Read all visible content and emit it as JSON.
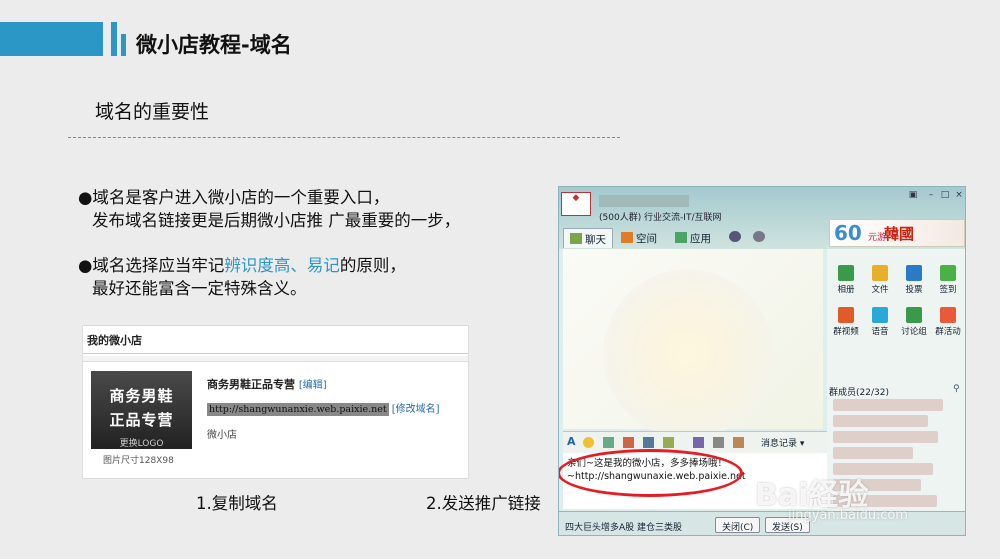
{
  "header": {
    "title": "微小店教程-域名"
  },
  "section": {
    "title": "域名的重要性"
  },
  "bullets": {
    "b1_line1": "●域名是客户进入微小店的一个重要入口，",
    "b1_line2": "发布域名链接更是后期微小店推 广最重要的一步，",
    "b2_pre": "●域名选择应当牢记",
    "b2_hl": "辨识度高、易记",
    "b2_post": "的原则，",
    "b2_line2": "最好还能富含一定特殊含义。"
  },
  "shop": {
    "header": "我的微小店",
    "logo_line1": "商务男鞋",
    "logo_line2": "正品专营",
    "logo_change": "更换LOGO",
    "logo_size": "图片尺寸128X98",
    "name": "商务男鞋正品专营",
    "edit_link": "[编辑]",
    "url": "http://shangwunanxie.web.paixie.net",
    "modify_link": "[修改域名]",
    "desc": "微小店"
  },
  "captions": {
    "step1": "1.复制域名",
    "step2": "2.发送推广链接"
  },
  "qq": {
    "group_info": "(500人群) 行业交流-IT/互联网",
    "tabs": [
      "聊天",
      "空间",
      "应用"
    ],
    "banner_num": "60",
    "banner_unit": "元游",
    "banner_korea": "韓國",
    "apps": [
      "相册",
      "文件",
      "投票",
      "签到",
      "群视频",
      "语音",
      "讨论组",
      "群活动"
    ],
    "members": "群成员(22/32)",
    "toolbar_record": "消息记录",
    "message_line1": "亲们~这是我的微小店，多多捧场哦！",
    "message_line2": "~http://shangwunaxie.web.paixie.net",
    "ad_text": "四大巨头增多A股 建仓三类股",
    "close_btn": "关闭(C)",
    "send_btn": "发送(S)"
  },
  "watermark": {
    "brand": "Bai経验",
    "url": "jingyan.baidu.com"
  }
}
